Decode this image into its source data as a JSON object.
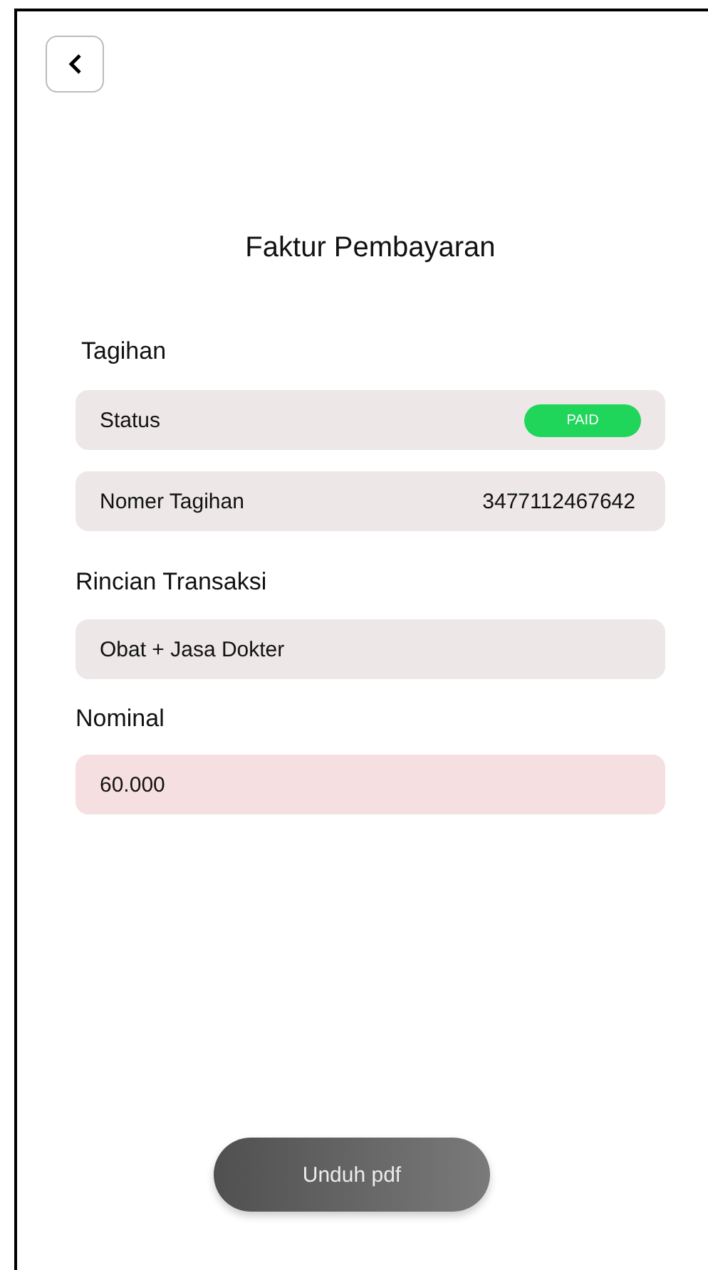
{
  "title": "Faktur Pembayaran",
  "sections": [
    {
      "heading": "Tagihan",
      "rows": [
        {
          "kind": "badge",
          "label": "Status",
          "value": "PAID",
          "color": "#1fd65a"
        },
        {
          "kind": "text",
          "label": "Nomer Tagihan",
          "value": "3477112467642"
        }
      ]
    },
    {
      "heading": "Rincian Transaksi",
      "rows": [
        {
          "kind": "plain",
          "value": "Obat + Jasa Dokter"
        }
      ]
    },
    {
      "heading": "Nominal",
      "rows": [
        {
          "kind": "amount",
          "value": "60.000"
        }
      ]
    }
  ],
  "button": "Unduh pdf"
}
